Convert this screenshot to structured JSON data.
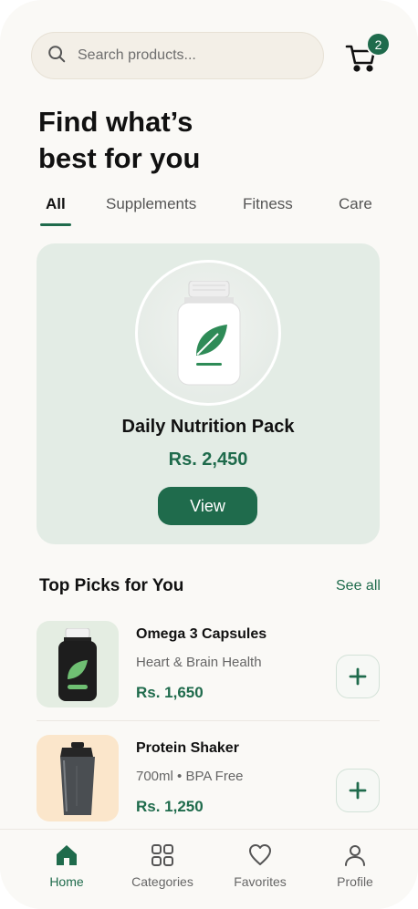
{
  "search": {
    "placeholder": "Search products..."
  },
  "cart": {
    "badge_count": "2",
    "icon": "cart-icon"
  },
  "headline": {
    "line1": "Find what’s",
    "line2": "best for you"
  },
  "tabs": [
    {
      "label": "All",
      "active": true
    },
    {
      "label": "Supplements",
      "active": false
    },
    {
      "label": "Fitness",
      "active": false
    },
    {
      "label": "Care",
      "active": false
    }
  ],
  "featured": {
    "name": "Daily Nutrition Pack",
    "price": "Rs. 2,450",
    "button_label": "View",
    "icon": "supplement-bottle-icon"
  },
  "section": {
    "title": "Top Picks for You",
    "see_all": "See all"
  },
  "products": [
    {
      "name": "Omega 3 Capsules",
      "subtitle": "Heart & Brain Health",
      "price": "Rs. 1,650",
      "icon": "capsule-bottle-icon",
      "bg_color": "#e4ede2"
    },
    {
      "name": "Protein Shaker",
      "subtitle": "700ml • BPA Free",
      "price": "Rs. 1,250",
      "icon": "shaker-bottle-icon",
      "bg_color": "#fbe6cb"
    }
  ],
  "bottom_nav": [
    {
      "label": "Home",
      "icon": "home-icon",
      "active": true
    },
    {
      "label": "Categories",
      "icon": "grid-icon",
      "active": false
    },
    {
      "label": "Favorites",
      "icon": "heart-icon",
      "active": false
    },
    {
      "label": "Profile",
      "icon": "user-icon",
      "active": false
    }
  ],
  "colors": {
    "accent": "#1f6b4c",
    "background": "#faf9f6",
    "featured_bg": "#e3ece5"
  }
}
